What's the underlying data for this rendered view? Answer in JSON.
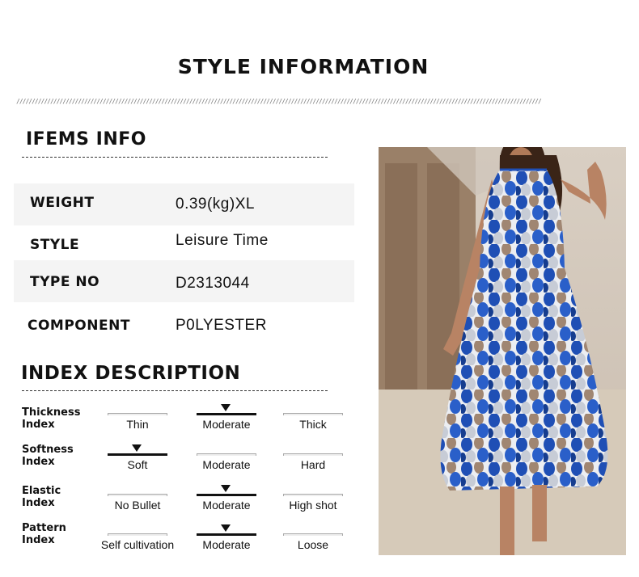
{
  "header": {
    "title": "STYLE INFORMATION"
  },
  "items_info": {
    "heading": "IFEMS INFO",
    "rows": [
      {
        "label": "WEIGHT",
        "value": "0.39(kg)XL"
      },
      {
        "label": "STYLE",
        "value": "Leisure Time"
      },
      {
        "label": "TYPE NO",
        "value": "D2313044"
      },
      {
        "label": "COMPONENT",
        "value": "P0LYESTER"
      }
    ]
  },
  "index_description": {
    "heading": "INDEX DESCRIPTION",
    "indexes": [
      {
        "name_line1": "Thickness",
        "name_line2": "Index",
        "options": [
          "Thin",
          "Moderate",
          "Thick"
        ],
        "selected": 1
      },
      {
        "name_line1": "Softness",
        "name_line2": "Index",
        "options": [
          "Soft",
          "Moderate",
          "Hard"
        ],
        "selected": 0
      },
      {
        "name_line1": "Elastic",
        "name_line2": "Index",
        "options": [
          "No Bullet",
          "Moderate",
          "High shot"
        ],
        "selected": 1
      },
      {
        "name_line1": "Pattern",
        "name_line2": "Index",
        "options": [
          "Self cultivation",
          "Moderate",
          "Loose"
        ],
        "selected": 1
      }
    ]
  },
  "colors": {
    "accent": "#111111",
    "row_shade": "#f4f4f4",
    "dress_blue": "#1f4fb5",
    "dress_tan": "#a08672"
  }
}
